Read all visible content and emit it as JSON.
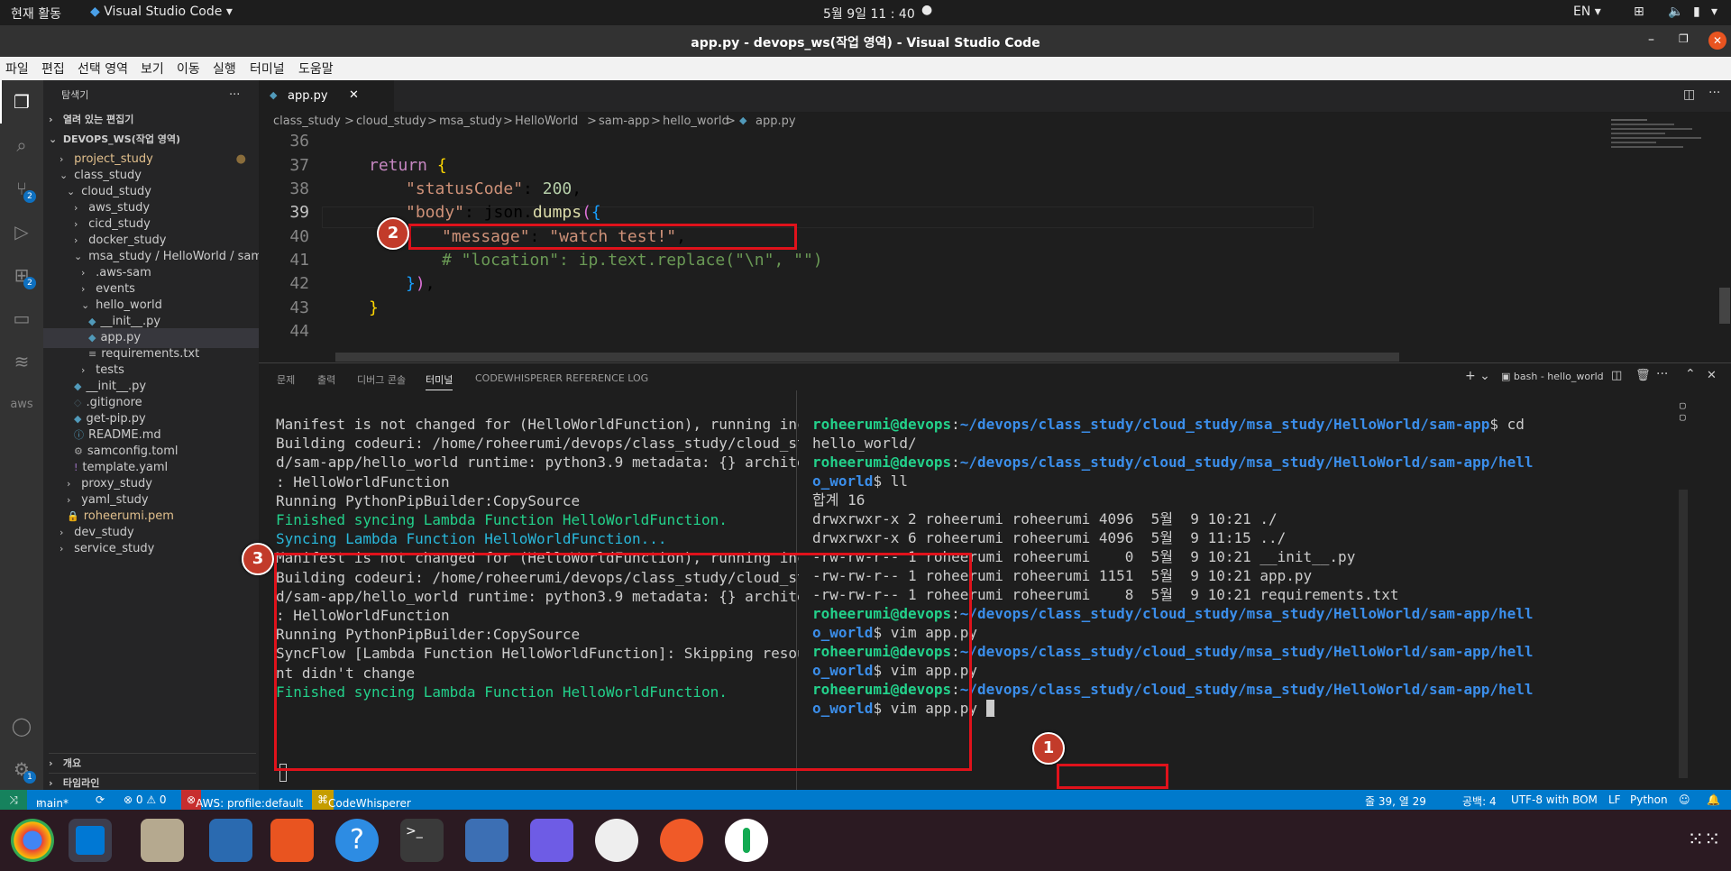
{
  "topbar": {
    "activities": "현재 활동",
    "app": "Visual Studio Code",
    "clock": "5월 9일  11 : 40",
    "lang": "EN"
  },
  "window": {
    "title": "app.py - devops_ws(작업 영역) - Visual Studio Code"
  },
  "menu": [
    "파일",
    "편집",
    "선택 영역",
    "보기",
    "이동",
    "실행",
    "터미널",
    "도움말"
  ],
  "activity": {
    "scm_badge": "2",
    "ext_badge": "2",
    "settings_badge": "1",
    "aws_label": "aws"
  },
  "sidebar": {
    "header": "탐색기",
    "open_editors": "열려 있는 편집기",
    "workspace": "DEVOPS_WS(작업 영역)",
    "items": [
      "project_study",
      "class_study",
      "cloud_study",
      "aws_study",
      "cicd_study",
      "docker_study",
      "msa_study / HelloWorld / sam-...",
      ".aws-sam",
      "events",
      "hello_world",
      "__init__.py",
      "app.py",
      "requirements.txt",
      "tests",
      "__init__.py",
      ".gitignore",
      "get-pip.py",
      "README.md",
      "samconfig.toml",
      "template.yaml",
      "proxy_study",
      "yaml_study",
      "roheerumi.pem",
      "dev_study",
      "service_study"
    ],
    "outline": "개요",
    "timeline": "타임라인"
  },
  "editor": {
    "tab": "app.py",
    "breadcrumb": [
      "class_study",
      ">",
      "cloud_study",
      ">",
      "msa_study",
      ">",
      "HelloWorld",
      ">",
      "sam-app",
      ">",
      "hello_world",
      ">",
      "app.py"
    ],
    "line_numbers": [
      "36",
      "37",
      "38",
      "39",
      "40",
      "41",
      "42",
      "43",
      "44"
    ]
  },
  "panel": {
    "tabs": [
      "문제",
      "출력",
      "디버그 콘솔",
      "터미널",
      "CODEWHISPERER REFERENCE LOG"
    ],
    "terminal_name": "bash - hello_world",
    "left": [
      "Manifest is not changed for (HelloWorldFunction), running incremental build",
      "Building codeuri: /home/roheerumi/devops/class_study/cloud_study/msa_study/HelloWorl",
      "d/sam-app/hello_world runtime: python3.9 metadata: {} architecture: x86_64 functions",
      ": HelloWorldFunction",
      "Running PythonPipBuilder:CopySource",
      "Finished syncing Lambda Function HelloWorldFunction.",
      "Syncing Lambda Function HelloWorldFunction...",
      "Manifest is not changed for (HelloWorldFunction), running incremental build",
      "Building codeuri: /home/roheerumi/devops/class_study/cloud_study/msa_study/HelloWorl",
      "d/sam-app/hello_world runtime: python3.9 metadata: {} architecture: x86_64 functions",
      ": HelloWorldFunction",
      "Running PythonPipBuilder:CopySource",
      "SyncFlow [Lambda Function HelloWorldFunction]: Skipping resource update as the conte",
      "nt didn't change",
      "Finished syncing Lambda Function HelloWorldFunction."
    ],
    "right": {
      "user": "roheerumi@devops",
      "path1": "~/devops/class_study/cloud_study/msa_study/HelloWorld/sam-app",
      "cmd_cd": "$ cd",
      "cd_arg": "hello_world/",
      "path2a": "~/devops/class_study/cloud_study/msa_study/HelloWorld/sam-app/hell",
      "path2b": "o_world",
      "cmd_ll": "$ ll",
      "total": "합계 16",
      "ls": [
        "drwxrwxr-x 2 roheerumi roheerumi 4096  5월  9 10:21 ./",
        "drwxrwxr-x 6 roheerumi roheerumi 4096  5월  9 11:15 ../",
        "-rw-rw-r-- 1 roheerumi roheerumi    0  5월  9 10:21 __init__.py",
        "-rw-rw-r-- 1 roheerumi roheerumi 1151  5월  9 10:21 app.py",
        "-rw-rw-r-- 1 roheerumi roheerumi    8  5월  9 10:21 requirements.txt"
      ],
      "cmd_vim": "$ vim app.py",
      "vim_tail": " vim app.py"
    }
  },
  "markers": [
    "1",
    "2",
    "3"
  ],
  "status": {
    "branch": "main*",
    "problems": "⊗ 0 ⚠ 0",
    "aws": "AWS: profile:default",
    "cw": "CodeWhisperer",
    "position": "줄 39, 열 29",
    "spaces": "공백: 4",
    "encoding": "UTF-8 with BOM",
    "eol": "LF",
    "lang": "Python"
  },
  "colors": {
    "accent": "#007acc",
    "highlight": "#e0121b",
    "marker": "#c23b2a"
  }
}
